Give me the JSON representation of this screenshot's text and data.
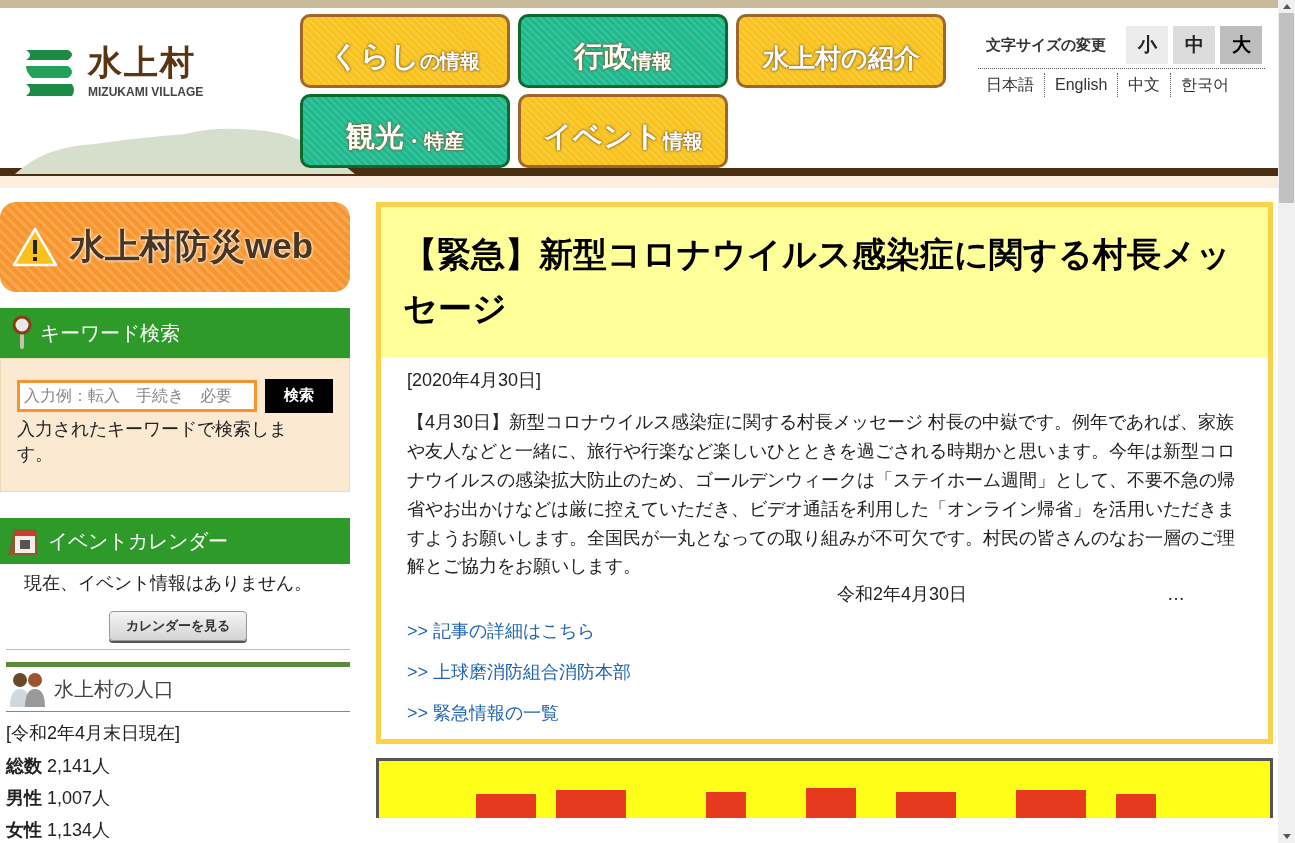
{
  "logo": {
    "name": "水上村",
    "subtitle": "MIZUKAMI VILLAGE"
  },
  "nav": [
    {
      "main": "くらし",
      "sub": "の情報",
      "color": "#f9c31f"
    },
    {
      "main": "行政",
      "sub": "情報",
      "color": "#1fb98e"
    },
    {
      "sub": "水上村の紹介",
      "color": "#f9c31f"
    },
    {
      "main": "観光",
      "sub": "・特産",
      "color": "#1fb98e"
    },
    {
      "main": "イベント",
      "sub": "情報",
      "color": "#f9c31f"
    }
  ],
  "font_size": {
    "label": "文字サイズの変更",
    "options": [
      {
        "label": "小",
        "selected": false
      },
      {
        "label": "中",
        "selected": false
      },
      {
        "label": "大",
        "selected": true
      }
    ]
  },
  "languages": [
    "日本語",
    "English",
    "中文",
    "한국어"
  ],
  "sidebar": {
    "disaster_banner": "水上村防災web",
    "keyword_search": {
      "title": "キーワード検索",
      "placeholder": "入力例：転入　手続き　必要",
      "button": "検索",
      "note": "入力されたキーワードで検索します。"
    },
    "event_calendar": {
      "title": "イベントカレンダー",
      "message": "現在、イベント情報はありません。",
      "button": "カレンダーを見る"
    },
    "population": {
      "title": "水上村の人口",
      "date": "[令和2年4月末日現在]",
      "rows": [
        {
          "label": "総数",
          "value": "2,141人"
        },
        {
          "label": "男性",
          "value": "1,007人"
        },
        {
          "label": "女性",
          "value": "1,134人"
        }
      ]
    }
  },
  "notice": {
    "title": "【緊急】新型コロナウイルス感染症に関する村長メッセージ",
    "date": "[2020年4月30日]",
    "body": "【4月30日】新型コロナウイルス感染症に関する村長メッセージ 村長の中嶽です。例年であれば、家族や友人などと一緒に、旅行や行楽など楽しいひとときを過ごされる時期かと思います。今年は新型コロナウイルスの感染拡大防止のため、ゴールデンウィークは「ステイホーム週間」として、不要不急の帰省やお出かけなどは厳に控えていただき、ビデオ通話を利用した「オンライン帰省」を活用いただきますようお願いします。全国民が一丸となっての取り組みが不可欠です。村民の皆さんのなお一層のご理解とご協力をお願いします。",
    "signature": "令和2年4月30日",
    "ellipsis": "…",
    "links": [
      ">> 記事の詳細はこちら",
      ">> 上球磨消防組合消防本部",
      ">> 緊急情報の一覧"
    ]
  },
  "banner": {
    "kind": "picture"
  }
}
